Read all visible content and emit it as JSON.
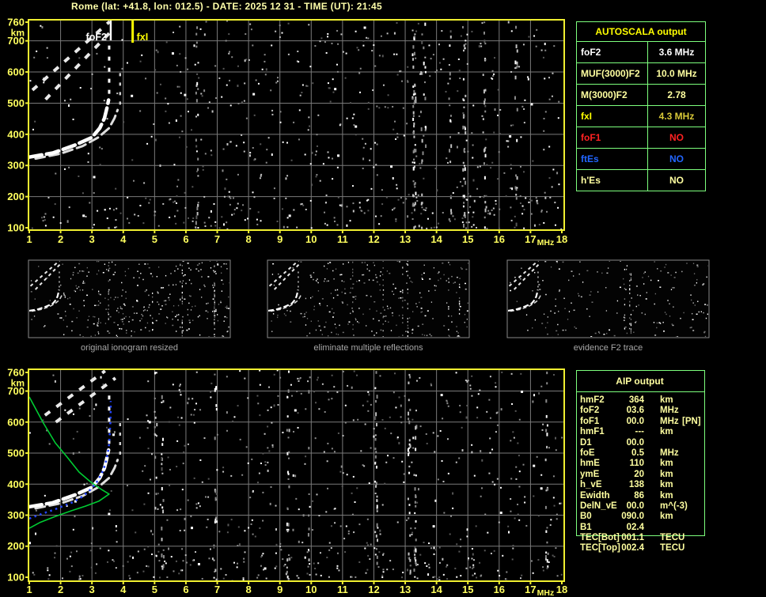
{
  "title": "Rome (lat: +41.8, lon: 012.5) - DATE: 2025 12 31 - TIME (UT): 21:45",
  "colors": {
    "plot_border": "#f0ef30",
    "axis_label": "#ffff5e",
    "grid": "#7a7a7a",
    "table_border": "#7dff7d",
    "title_text": "#ffffaa",
    "caption_gray": "#a8a8a8",
    "green_profile": "#00cc33",
    "blue_fit": "#2244ff",
    "trace_white": "#ffffff",
    "marker_fof2": "#ffffff",
    "marker_fxi": "#ffff00"
  },
  "autoscala_table": {
    "header": "AUTOSCALA output",
    "rows": [
      {
        "label": "foF2",
        "value": "3.6 MHz",
        "color": "#ffffff",
        "value_color": "#ffffff"
      },
      {
        "label": "MUF(3000)F2",
        "value": "10.0 MHz",
        "color": "#ffffa0",
        "value_color": "#ffffa0"
      },
      {
        "label": "M(3000)F2",
        "value": "2.78",
        "color": "#ffffa0",
        "value_color": "#ffffa0"
      },
      {
        "label": "fxI",
        "value": "4.3 MHz",
        "color": "#ffff00",
        "value_color": "#d8c838"
      },
      {
        "label": "foF1",
        "value": "NO",
        "color": "#ff2222",
        "value_color": "#ff2222"
      },
      {
        "label": "ftEs",
        "value": "NO",
        "color": "#2266ff",
        "value_color": "#2266ff"
      },
      {
        "label": "h'Es",
        "value": "NO",
        "color": "#ffffa0",
        "value_color": "#ffffa0"
      }
    ]
  },
  "aip_table": {
    "header": "AIP output",
    "rows": [
      {
        "label": "hmF2",
        "value": "364",
        "unit": "km",
        "extra": ""
      },
      {
        "label": "foF2",
        "value": "03.6",
        "unit": "MHz",
        "extra": ""
      },
      {
        "label": "foF1",
        "value": "00.0",
        "unit": "MHz",
        "extra": "[PN]"
      },
      {
        "label": "hmF1",
        "value": "---",
        "unit": "km",
        "extra": ""
      },
      {
        "label": "D1",
        "value": "00.0",
        "unit": "",
        "extra": ""
      },
      {
        "label": "foE",
        "value": "0.5",
        "unit": "MHz",
        "extra": ""
      },
      {
        "label": "hmE",
        "value": "110",
        "unit": "km",
        "extra": ""
      },
      {
        "label": "ymE",
        "value": "20",
        "unit": "km",
        "extra": ""
      },
      {
        "label": "h_vE",
        "value": "138",
        "unit": "km",
        "extra": ""
      },
      {
        "label": "Ewidth",
        "value": "86",
        "unit": "km",
        "extra": ""
      },
      {
        "label": "DelN_vE",
        "value": "00.0",
        "unit": "m^(-3)",
        "extra": ""
      },
      {
        "label": "B0",
        "value": "090.0",
        "unit": "km",
        "extra": ""
      },
      {
        "label": "B1",
        "value": "02.4",
        "unit": "",
        "extra": ""
      },
      {
        "label": "TEC[Bot]",
        "value": "001.1",
        "unit": "TECU",
        "extra": ""
      },
      {
        "label": "TEC[Top]",
        "value": "002.4",
        "unit": "TECU",
        "extra": ""
      }
    ]
  },
  "thumbnails": [
    {
      "caption": "original ionogram resized"
    },
    {
      "caption": "eliminate multiple reflections"
    },
    {
      "caption": "evidence F2 trace"
    }
  ],
  "chart_data": {
    "type": "scatter",
    "panels": [
      {
        "id": "top-ionogram",
        "xlabel": "MHz",
        "ylabel": "km",
        "xlim": [
          1,
          18
        ],
        "ylim": [
          100,
          760
        ],
        "x_ticks": [
          1,
          2,
          3,
          4,
          5,
          6,
          7,
          8,
          9,
          10,
          11,
          12,
          13,
          14,
          15,
          16,
          17,
          18
        ],
        "y_ticks": [
          760,
          700,
          600,
          500,
          400,
          300,
          200,
          100
        ],
        "grid": true,
        "markers": [
          {
            "name": "foF2",
            "freq_mhz": 3.6,
            "color": "#ffffff"
          },
          {
            "name": "fxI",
            "freq_mhz": 4.3,
            "color": "#ffff00"
          }
        ],
        "second_hop_segments": [
          [
            [
              1.1,
              542
            ],
            [
              3.57,
              762
            ]
          ],
          [
            [
              1.52,
              512
            ],
            [
              3.72,
              742
            ]
          ]
        ],
        "noise_seed": 12345
      },
      {
        "id": "bottom-ionogram",
        "xlabel": "MHz",
        "ylabel": "km",
        "xlim": [
          1,
          18
        ],
        "ylim": [
          100,
          760
        ],
        "x_ticks": [
          1,
          2,
          3,
          4,
          5,
          6,
          7,
          8,
          9,
          10,
          11,
          12,
          13,
          14,
          15,
          16,
          17,
          18
        ],
        "y_ticks": [
          760,
          700,
          600,
          500,
          400,
          300,
          200,
          100
        ],
        "grid": true,
        "markers": [],
        "second_hop_segments": [
          [
            [
              1.5,
              622
            ],
            [
              3.42,
              765
            ]
          ],
          [
            [
              1.85,
              600
            ],
            [
              3.75,
              742
            ]
          ]
        ],
        "noise_seed": 67890
      }
    ],
    "traces": {
      "o_trace": [
        [
          1.0,
          327
        ],
        [
          1.75,
          340
        ],
        [
          2.45,
          365
        ],
        [
          3.0,
          390
        ],
        [
          3.25,
          420
        ],
        [
          3.4,
          452
        ],
        [
          3.48,
          485
        ],
        [
          3.53,
          510
        ]
      ],
      "o_asymptote": {
        "freq_mhz": 3.55,
        "km_range": [
          530,
          690
        ]
      },
      "x_trace": [
        [
          1.2,
          322
        ],
        [
          2.0,
          338
        ],
        [
          2.7,
          362
        ],
        [
          3.2,
          390
        ],
        [
          3.55,
          420
        ],
        [
          3.72,
          452
        ],
        [
          3.82,
          478
        ]
      ],
      "x_asymptote": {
        "freq_mhz": 3.9,
        "km_range": [
          495,
          600
        ]
      },
      "green_profile": [
        [
          1.0,
          681
        ],
        [
          1.45,
          597
        ],
        [
          1.83,
          533
        ],
        [
          2.21,
          487
        ],
        [
          2.59,
          439
        ],
        [
          2.97,
          406
        ],
        [
          3.3,
          383
        ],
        [
          3.55,
          368
        ],
        [
          3.22,
          345
        ],
        [
          2.79,
          329
        ],
        [
          2.34,
          314
        ],
        [
          1.83,
          296
        ],
        [
          1.33,
          276
        ],
        [
          1.0,
          258
        ]
      ],
      "blue_fit": [
        [
          1.0,
          289
        ],
        [
          1.4,
          304
        ],
        [
          1.8,
          318
        ],
        [
          2.1,
          330
        ],
        [
          2.4,
          342
        ],
        [
          2.7,
          360
        ],
        [
          2.95,
          382
        ],
        [
          3.15,
          406
        ],
        [
          3.3,
          432
        ],
        [
          3.42,
          462
        ],
        [
          3.5,
          497
        ],
        [
          3.55,
          530
        ],
        [
          3.57,
          565
        ],
        [
          3.59,
          600
        ],
        [
          3.6,
          640
        ],
        [
          3.6,
          668
        ]
      ]
    },
    "key_values": {
      "foF2_mhz": 3.6,
      "fxI_mhz": 4.3,
      "hmF2_km": 364
    }
  }
}
